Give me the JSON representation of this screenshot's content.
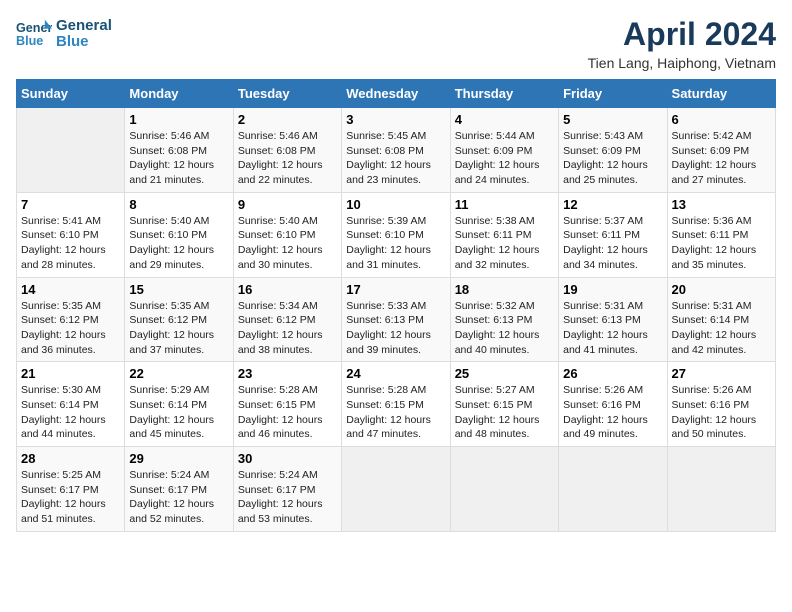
{
  "header": {
    "logo_line1": "General",
    "logo_line2": "Blue",
    "title": "April 2024",
    "subtitle": "Tien Lang, Haiphong, Vietnam"
  },
  "weekdays": [
    "Sunday",
    "Monday",
    "Tuesday",
    "Wednesday",
    "Thursday",
    "Friday",
    "Saturday"
  ],
  "weeks": [
    [
      {
        "day": "",
        "sunrise": "",
        "sunset": "",
        "daylight": ""
      },
      {
        "day": "1",
        "sunrise": "Sunrise: 5:46 AM",
        "sunset": "Sunset: 6:08 PM",
        "daylight": "Daylight: 12 hours and 21 minutes."
      },
      {
        "day": "2",
        "sunrise": "Sunrise: 5:46 AM",
        "sunset": "Sunset: 6:08 PM",
        "daylight": "Daylight: 12 hours and 22 minutes."
      },
      {
        "day": "3",
        "sunrise": "Sunrise: 5:45 AM",
        "sunset": "Sunset: 6:08 PM",
        "daylight": "Daylight: 12 hours and 23 minutes."
      },
      {
        "day": "4",
        "sunrise": "Sunrise: 5:44 AM",
        "sunset": "Sunset: 6:09 PM",
        "daylight": "Daylight: 12 hours and 24 minutes."
      },
      {
        "day": "5",
        "sunrise": "Sunrise: 5:43 AM",
        "sunset": "Sunset: 6:09 PM",
        "daylight": "Daylight: 12 hours and 25 minutes."
      },
      {
        "day": "6",
        "sunrise": "Sunrise: 5:42 AM",
        "sunset": "Sunset: 6:09 PM",
        "daylight": "Daylight: 12 hours and 27 minutes."
      }
    ],
    [
      {
        "day": "7",
        "sunrise": "Sunrise: 5:41 AM",
        "sunset": "Sunset: 6:10 PM",
        "daylight": "Daylight: 12 hours and 28 minutes."
      },
      {
        "day": "8",
        "sunrise": "Sunrise: 5:40 AM",
        "sunset": "Sunset: 6:10 PM",
        "daylight": "Daylight: 12 hours and 29 minutes."
      },
      {
        "day": "9",
        "sunrise": "Sunrise: 5:40 AM",
        "sunset": "Sunset: 6:10 PM",
        "daylight": "Daylight: 12 hours and 30 minutes."
      },
      {
        "day": "10",
        "sunrise": "Sunrise: 5:39 AM",
        "sunset": "Sunset: 6:10 PM",
        "daylight": "Daylight: 12 hours and 31 minutes."
      },
      {
        "day": "11",
        "sunrise": "Sunrise: 5:38 AM",
        "sunset": "Sunset: 6:11 PM",
        "daylight": "Daylight: 12 hours and 32 minutes."
      },
      {
        "day": "12",
        "sunrise": "Sunrise: 5:37 AM",
        "sunset": "Sunset: 6:11 PM",
        "daylight": "Daylight: 12 hours and 34 minutes."
      },
      {
        "day": "13",
        "sunrise": "Sunrise: 5:36 AM",
        "sunset": "Sunset: 6:11 PM",
        "daylight": "Daylight: 12 hours and 35 minutes."
      }
    ],
    [
      {
        "day": "14",
        "sunrise": "Sunrise: 5:35 AM",
        "sunset": "Sunset: 6:12 PM",
        "daylight": "Daylight: 12 hours and 36 minutes."
      },
      {
        "day": "15",
        "sunrise": "Sunrise: 5:35 AM",
        "sunset": "Sunset: 6:12 PM",
        "daylight": "Daylight: 12 hours and 37 minutes."
      },
      {
        "day": "16",
        "sunrise": "Sunrise: 5:34 AM",
        "sunset": "Sunset: 6:12 PM",
        "daylight": "Daylight: 12 hours and 38 minutes."
      },
      {
        "day": "17",
        "sunrise": "Sunrise: 5:33 AM",
        "sunset": "Sunset: 6:13 PM",
        "daylight": "Daylight: 12 hours and 39 minutes."
      },
      {
        "day": "18",
        "sunrise": "Sunrise: 5:32 AM",
        "sunset": "Sunset: 6:13 PM",
        "daylight": "Daylight: 12 hours and 40 minutes."
      },
      {
        "day": "19",
        "sunrise": "Sunrise: 5:31 AM",
        "sunset": "Sunset: 6:13 PM",
        "daylight": "Daylight: 12 hours and 41 minutes."
      },
      {
        "day": "20",
        "sunrise": "Sunrise: 5:31 AM",
        "sunset": "Sunset: 6:14 PM",
        "daylight": "Daylight: 12 hours and 42 minutes."
      }
    ],
    [
      {
        "day": "21",
        "sunrise": "Sunrise: 5:30 AM",
        "sunset": "Sunset: 6:14 PM",
        "daylight": "Daylight: 12 hours and 44 minutes."
      },
      {
        "day": "22",
        "sunrise": "Sunrise: 5:29 AM",
        "sunset": "Sunset: 6:14 PM",
        "daylight": "Daylight: 12 hours and 45 minutes."
      },
      {
        "day": "23",
        "sunrise": "Sunrise: 5:28 AM",
        "sunset": "Sunset: 6:15 PM",
        "daylight": "Daylight: 12 hours and 46 minutes."
      },
      {
        "day": "24",
        "sunrise": "Sunrise: 5:28 AM",
        "sunset": "Sunset: 6:15 PM",
        "daylight": "Daylight: 12 hours and 47 minutes."
      },
      {
        "day": "25",
        "sunrise": "Sunrise: 5:27 AM",
        "sunset": "Sunset: 6:15 PM",
        "daylight": "Daylight: 12 hours and 48 minutes."
      },
      {
        "day": "26",
        "sunrise": "Sunrise: 5:26 AM",
        "sunset": "Sunset: 6:16 PM",
        "daylight": "Daylight: 12 hours and 49 minutes."
      },
      {
        "day": "27",
        "sunrise": "Sunrise: 5:26 AM",
        "sunset": "Sunset: 6:16 PM",
        "daylight": "Daylight: 12 hours and 50 minutes."
      }
    ],
    [
      {
        "day": "28",
        "sunrise": "Sunrise: 5:25 AM",
        "sunset": "Sunset: 6:17 PM",
        "daylight": "Daylight: 12 hours and 51 minutes."
      },
      {
        "day": "29",
        "sunrise": "Sunrise: 5:24 AM",
        "sunset": "Sunset: 6:17 PM",
        "daylight": "Daylight: 12 hours and 52 minutes."
      },
      {
        "day": "30",
        "sunrise": "Sunrise: 5:24 AM",
        "sunset": "Sunset: 6:17 PM",
        "daylight": "Daylight: 12 hours and 53 minutes."
      },
      {
        "day": "",
        "sunrise": "",
        "sunset": "",
        "daylight": ""
      },
      {
        "day": "",
        "sunrise": "",
        "sunset": "",
        "daylight": ""
      },
      {
        "day": "",
        "sunrise": "",
        "sunset": "",
        "daylight": ""
      },
      {
        "day": "",
        "sunrise": "",
        "sunset": "",
        "daylight": ""
      }
    ]
  ]
}
